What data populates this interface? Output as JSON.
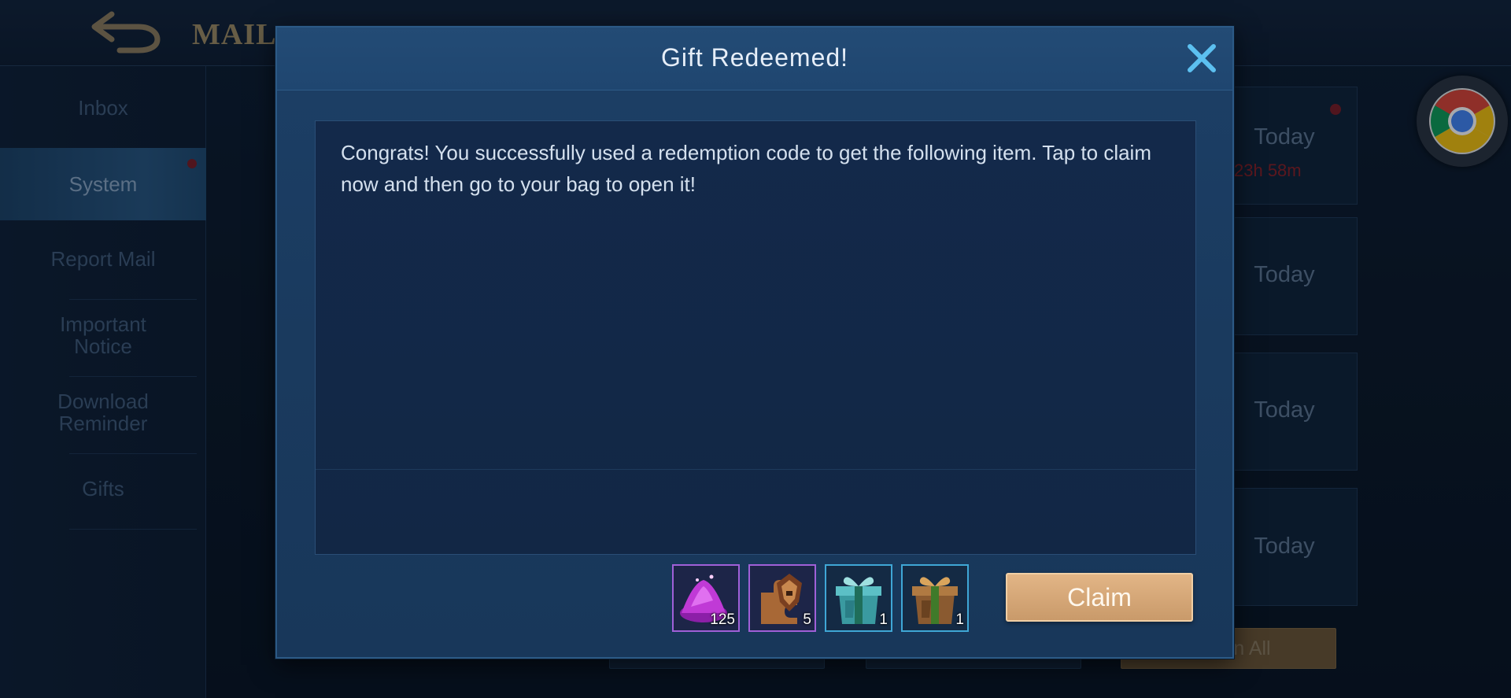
{
  "header": {
    "title": "MAIL"
  },
  "sidebar": {
    "items": [
      {
        "label": "Inbox"
      },
      {
        "label": "System"
      },
      {
        "label": "Report Mail"
      },
      {
        "label": "Important Notice"
      },
      {
        "label": "Download Reminder"
      },
      {
        "label": "Gifts"
      }
    ],
    "active": "System"
  },
  "mail_list": [
    {
      "date": "Today",
      "timer": "23h 58m"
    },
    {
      "date": "Today"
    },
    {
      "date": "Today"
    },
    {
      "date": "Today"
    }
  ],
  "bottom_bar": {
    "claim_all_label": "n All"
  },
  "dialog": {
    "title": "Gift Redeemed!",
    "message": "Congrats! You successfully used a redemption code to get the following item. Tap to claim now and then go to your bag to open it!",
    "claim_label": "Claim",
    "items": [
      {
        "icon": "magic-dust-icon",
        "count": "125"
      },
      {
        "icon": "hero-fragment-icon",
        "count": "5"
      },
      {
        "icon": "blue-gift-box-icon",
        "count": "1"
      },
      {
        "icon": "bronze-gift-box-icon",
        "count": "1"
      }
    ]
  },
  "colors": {
    "claim_button": "#d9aa7a",
    "accent_blue": "#3fa7d6",
    "rare_purple": "#a060d8",
    "timer_red": "#8a2025"
  }
}
